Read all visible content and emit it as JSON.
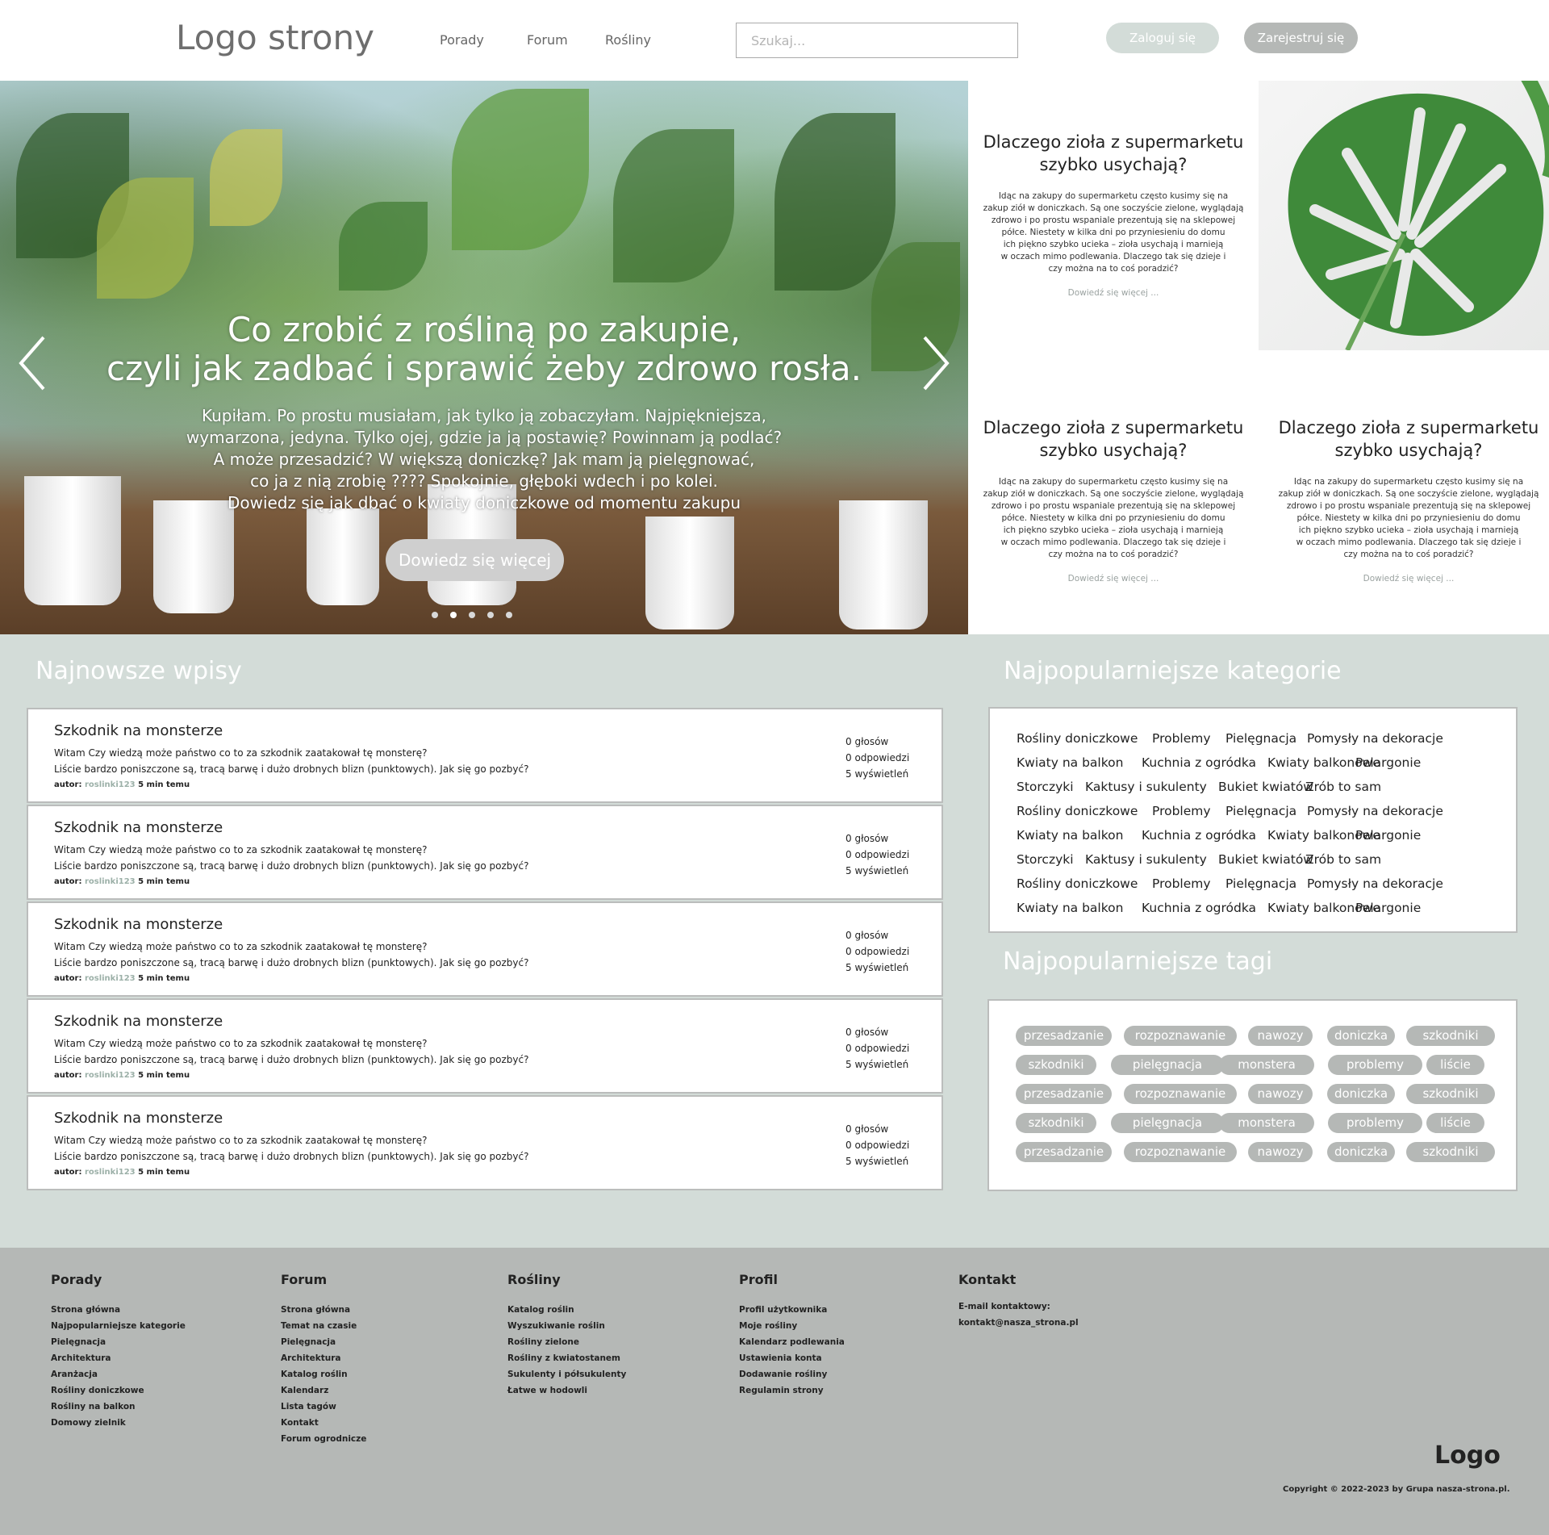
{
  "header": {
    "logo": "Logo strony",
    "nav": [
      "Porady",
      "Forum",
      "Rośliny"
    ],
    "search_placeholder": "Szukaj...",
    "login_label": "Zaloguj się",
    "register_label": "Zarejestruj się"
  },
  "hero": {
    "title_line1": "Co zrobić z rośliną po zakupie,",
    "title_line2": "czyli jak zadbać i sprawić żeby zdrowo rosła.",
    "text_lines": [
      "Kupiłam. Po prostu musiałam, jak tylko ją zobaczyłam. Najpiękniejsza,",
      "wymarzona, jedyna. Tylko ojej, gdzie ja ją postawię? Powinnam ją podlać?",
      "A może przesadzić? W większą doniczkę? Jak mam ją pielęgnować,",
      "co ja z nią zrobię ???? Spokojnie, głęboki wdech i po kolei.",
      "Dowiedz się jak dbać o kwiaty doniczkowe od momentu zakupu"
    ],
    "button_label": "Dowiedz się więcej",
    "arrow_left": "chevron-left-icon",
    "arrow_right": "chevron-right-icon",
    "slide_count": 5,
    "active_slide": 2
  },
  "articles": [
    {
      "title_line1": "Dlaczego zioła z supermarketu",
      "title_line2": "szybko usychają?",
      "text_lines": [
        "Idąc na zakupy do supermarketu często kusimy się na",
        "zakup ziół w doniczkach. Są one soczyście zielone, wyglądają",
        "zdrowo i po prostu wspaniale prezentują się na sklepowej",
        "półce. Niestety w kilka dni po przyniesieniu do domu",
        "ich piękno szybko ucieka – zioła usychają i marnieją",
        "w oczach mimo podlewania. Dlaczego tak się dzieje i",
        "czy można na to coś poradzić?"
      ],
      "link": "Dowiedź się więcej ..."
    },
    {
      "title_line1": "Dlaczego zioła z supermarketu",
      "title_line2": "szybko usychają?",
      "text_lines": [
        "Idąc na zakupy do supermarketu często kusimy się na",
        "zakup ziół w doniczkach. Są one soczyście zielone, wyglądają",
        "zdrowo i po prostu wspaniale prezentują się na sklepowej",
        "półce. Niestety w kilka dni po przyniesieniu do domu",
        "ich piękno szybko ucieka – zioła usychają i marnieją",
        "w oczach mimo podlewania. Dlaczego tak się dzieje i",
        "czy można na to coś poradzić?"
      ],
      "link": "Dowiedź się więcej ..."
    },
    {
      "title_line1": "Dlaczego zioła z supermarketu",
      "title_line2": "szybko usychają?",
      "text_lines": [
        "Idąc na zakupy do supermarketu często kusimy się na",
        "zakup ziół w doniczkach. Są one soczyście zielone, wyglądają",
        "zdrowo i po prostu wspaniale prezentują się na sklepowej",
        "półce. Niestety w kilka dni po przyniesieniu do domu",
        "ich piękno szybko ucieka – zioła usychają i marnieją",
        "w oczach mimo podlewania. Dlaczego tak się dzieje i",
        "czy można na to coś poradzić?"
      ],
      "link": "Dowiedź się więcej ..."
    }
  ],
  "latest": {
    "title": "Najnowsze wpisy",
    "posts": [
      {
        "title": "Szkodnik na monsterze",
        "line1": "Witam Czy wiedzą może państwo co to za szkodnik zaatakował tę monsterę?",
        "line2": "Liście bardzo poniszczone są, tracą barwę i dużo drobnych blizn (punktowych). Jak się go pozbyć?",
        "author_label": "autor:",
        "author": "roslinki123",
        "time": "5 min temu",
        "votes": "0 głosów",
        "answers": "0 odpowiedzi",
        "views": "5 wyświetleń"
      },
      {
        "title": "Szkodnik na monsterze",
        "line1": "Witam Czy wiedzą może państwo co to za szkodnik zaatakował tę monsterę?",
        "line2": "Liście bardzo poniszczone są, tracą barwę i dużo drobnych blizn (punktowych). Jak się go pozbyć?",
        "author_label": "autor:",
        "author": "roslinki123",
        "time": "5 min temu",
        "votes": "0 głosów",
        "answers": "0 odpowiedzi",
        "views": "5 wyświetleń"
      },
      {
        "title": "Szkodnik na monsterze",
        "line1": "Witam Czy wiedzą może państwo co to za szkodnik zaatakował tę monsterę?",
        "line2": "Liście bardzo poniszczone są, tracą barwę i dużo drobnych blizn (punktowych). Jak się go pozbyć?",
        "author_label": "autor:",
        "author": "roslinki123",
        "time": "5 min temu",
        "votes": "0 głosów",
        "answers": "0 odpowiedzi",
        "views": "5 wyświetleń"
      },
      {
        "title": "Szkodnik na monsterze",
        "line1": "Witam Czy wiedzą może państwo co to za szkodnik zaatakował tę monsterę?",
        "line2": "Liście bardzo poniszczone są, tracą barwę i dużo drobnych blizn (punktowych). Jak się go pozbyć?",
        "author_label": "autor:",
        "author": "roslinki123",
        "time": "5 min temu",
        "votes": "0 głosów",
        "answers": "0 odpowiedzi",
        "views": "5 wyświetleń"
      },
      {
        "title": "Szkodnik na monsterze",
        "line1": "Witam Czy wiedzą może państwo co to za szkodnik zaatakował tę monsterę?",
        "line2": "Liście bardzo poniszczone są, tracą barwę i dużo drobnych blizn (punktowych). Jak się go pozbyć?",
        "author_label": "autor:",
        "author": "roslinki123",
        "time": "5 min temu",
        "votes": "0 głosów",
        "answers": "0 odpowiedzi",
        "views": "5 wyświetleń"
      }
    ]
  },
  "categories": {
    "title": "Najpopularniejsze kategorie",
    "rows": [
      [
        "Rośliny doniczkowe",
        "Problemy",
        "Pielęgnacja",
        "Pomysły na dekoracje"
      ],
      [
        "Kwiaty na balkon",
        "Kuchnia z ogródka",
        "Kwiaty balkonowe",
        "Pelargonie"
      ],
      [
        "Storczyki",
        "Kaktusy i sukulenty",
        "Bukiet kwiatów",
        "Zrób to sam"
      ],
      [
        "Rośliny doniczkowe",
        "Problemy",
        "Pielęgnacja",
        "Pomysły na dekoracje"
      ],
      [
        "Kwiaty na balkon",
        "Kuchnia z ogródka",
        "Kwiaty balkonowe",
        "Pelargonie"
      ],
      [
        "Storczyki",
        "Kaktusy i sukulenty",
        "Bukiet kwiatów",
        "Zrób to sam"
      ],
      [
        "Rośliny doniczkowe",
        "Problemy",
        "Pielęgnacja",
        "Pomysły na dekoracje"
      ],
      [
        "Kwiaty na balkon",
        "Kuchnia z ogródka",
        "Kwiaty balkonowe",
        "Pelargonie"
      ]
    ]
  },
  "tags": {
    "title": "Najpopularniejsze tagi",
    "rows": [
      [
        "przesadzanie",
        "rozpoznawanie",
        "nawozy",
        "doniczka",
        "szkodniki"
      ],
      [
        "szkodniki",
        "pielęgnacja",
        "monstera",
        "problemy",
        "liście"
      ],
      [
        "przesadzanie",
        "rozpoznawanie",
        "nawozy",
        "doniczka",
        "szkodniki"
      ],
      [
        "szkodniki",
        "pielęgnacja",
        "monstera",
        "problemy",
        "liście"
      ],
      [
        "przesadzanie",
        "rozpoznawanie",
        "nawozy",
        "doniczka",
        "szkodniki"
      ]
    ]
  },
  "footer": {
    "columns": [
      {
        "title": "Porady",
        "items": [
          "Strona główna",
          "Najpopularniejsze kategorie",
          "Pielęgnacja",
          "Architektura",
          "Aranżacja",
          "Rośliny doniczkowe",
          "Rośliny na balkon",
          "Domowy zielnik"
        ]
      },
      {
        "title": "Forum",
        "items": [
          "Strona główna",
          "Temat na czasie",
          "Pielęgnacja",
          "Architektura",
          "Katalog roślin",
          "Kalendarz",
          "Lista tagów",
          "Kontakt",
          "Forum ogrodnicze"
        ]
      },
      {
        "title": "Rośliny",
        "items": [
          "Katalog roślin",
          "Wyszukiwanie roślin",
          "Rośliny zielone",
          "Rośliny z kwiatostanem",
          "Sukulenty i półsukulenty",
          "Łatwe w hodowli"
        ]
      },
      {
        "title": "Profil",
        "items": [
          "Profil użytkownika",
          "Moje rośliny",
          "Kalendarz podlewania",
          "Ustawienia konta",
          "Dodawanie rośliny",
          "Regulamin strony"
        ]
      },
      {
        "title": "Kontakt",
        "items": [
          "E-mail kontaktowy:",
          "kontakt@nasza_strona.pl"
        ]
      }
    ],
    "logo": "Logo",
    "copyright": "Copyright © 2022-2023 by Grupa nasza-strona.pl."
  },
  "colors": {
    "main_bg": "#d3dcd8",
    "footer_bg": "#b5b8b6",
    "pill_grey": "#b5b8b6",
    "login_bg": "#d3dcd8",
    "author_accent": "#9cb0a8"
  }
}
